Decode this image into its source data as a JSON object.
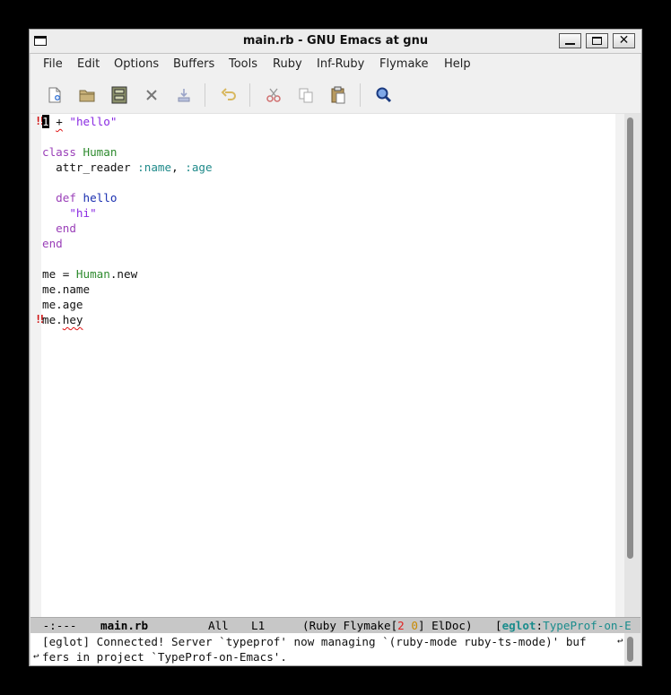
{
  "window": {
    "title": "main.rb - GNU Emacs at gnu",
    "close_glyph": "✕"
  },
  "menu": [
    "File",
    "Edit",
    "Options",
    "Buffers",
    "Tools",
    "Ruby",
    "Inf-Ruby",
    "Flymake",
    "Help"
  ],
  "toolbar": {
    "icons": [
      "new-file-icon",
      "open-folder-icon",
      "save-icon",
      "close-buffer-icon",
      "save-as-icon",
      "undo-icon",
      "cut-icon",
      "copy-icon",
      "paste-icon",
      "search-icon"
    ]
  },
  "editor": {
    "cursor_char": "1",
    "error_mark": "!!",
    "lines": {
      "l1_rest": " ",
      "l1_plus": "+",
      "l1_str": " \"hello\"",
      "l3_kw": "class",
      "l3_cls": " Human",
      "l4_a": "  attr_reader ",
      "l4_sym1": ":name",
      "l4_comma": ", ",
      "l4_sym2": ":age",
      "l6_kw": "  def",
      "l6_fn": " hello",
      "l7_str": "    \"hi\"",
      "l8_kw": "  end",
      "l9_kw": "end",
      "l11_a": "me = ",
      "l11_cls": "Human",
      "l11_b": ".new",
      "l12": "me.name",
      "l13": "me.age",
      "l14_a": "me.",
      "l14_err": "hey"
    }
  },
  "modeline": {
    "status": " -:---  ",
    "buffer": "main.rb",
    "position": "All",
    "line": "L1",
    "mode_open": "(Ruby Flymake[",
    "errors": "2",
    "warnings": "0",
    "mode_close": "] ElDoc)",
    "eglot_open": "[",
    "eglot": "eglot",
    "eglot_colon": ":",
    "project": "TypeProf-on-E"
  },
  "echo": {
    "line1": "[eglot] Connected! Server `typeprof' now managing `(ruby-mode ruby-ts-mode)' buf",
    "line2": "fers in project `TypeProf-on-Emacs'.",
    "wrap_glyph": "↩"
  }
}
